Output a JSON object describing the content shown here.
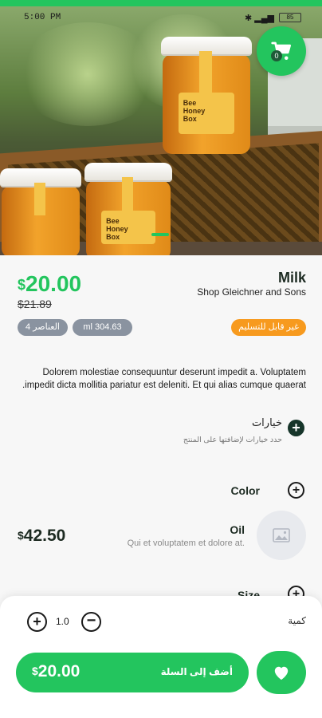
{
  "status_bar": {
    "time": "5:00 PM",
    "battery": "85"
  },
  "hero": {
    "jar_label": "Bee Honey Box",
    "cart_count": "0"
  },
  "product": {
    "price": "20.00",
    "currency": "$",
    "old_price": "$21.89",
    "name": "Milk",
    "shop": "Shop Gleichner and Sons"
  },
  "tags": {
    "items_count": "4 العناصر",
    "volume": "ml 304.63",
    "availability": "غير قابل للتسليم"
  },
  "description": "Dolorem molestiae consequuntur deserunt impedit a. Voluptatem impedit dicta mollitia pariatur est deleniti. Et qui alias cumque quaerat.",
  "options": {
    "title": "خيارات",
    "subtitle": "حدد خيارات لإضافتها على المنتج",
    "color_label": "Color",
    "size_label": "Size"
  },
  "oil_option": {
    "name": "Oil",
    "description": "Qui et voluptatem et dolore at.",
    "price": "42.50",
    "currency": "$"
  },
  "quantity": {
    "label": "كمية",
    "value": "1.0"
  },
  "add_to_cart": {
    "label": "أضف إلى السلة",
    "price": "20.00",
    "currency": "$"
  },
  "colors": {
    "accent": "#23c55e",
    "orange_badge": "#f79a1e",
    "grey_badge": "#8a93a0",
    "dark": "#16352a"
  },
  "icons": {
    "cart": "shopping-cart-icon",
    "heart": "heart-icon",
    "image": "image-placeholder-icon",
    "plus": "plus-icon",
    "minus": "minus-icon"
  }
}
